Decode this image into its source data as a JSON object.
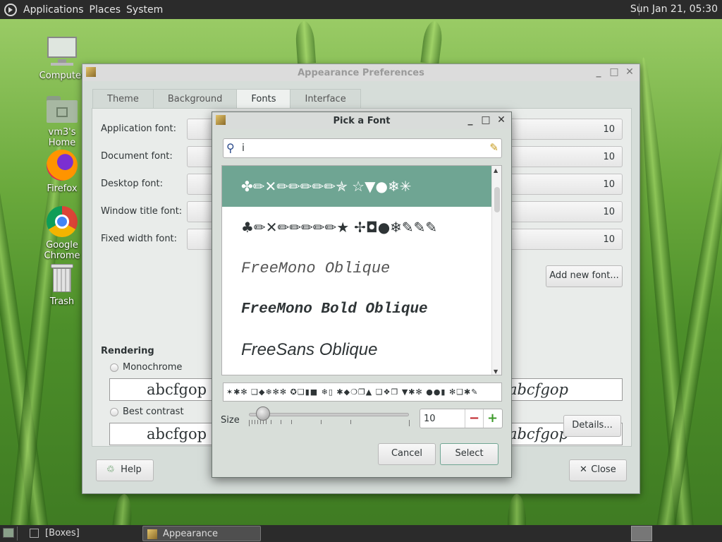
{
  "top_panel": {
    "menus": [
      "Applications",
      "Places",
      "System"
    ],
    "clock": "Sun Jan 21, 05:30"
  },
  "desktop_icons": [
    {
      "label": "Computer",
      "icon": "computer-icon"
    },
    {
      "label": "vm3's Home",
      "icon": "home-folder-icon"
    },
    {
      "label": "Firefox",
      "icon": "firefox-icon"
    },
    {
      "label": "Google Chrome",
      "icon": "chrome-icon"
    },
    {
      "label": "Trash",
      "icon": "trash-icon"
    }
  ],
  "appearance": {
    "title": "Appearance Preferences",
    "tabs": [
      "Theme",
      "Background",
      "Fonts",
      "Interface"
    ],
    "active_tab": "Fonts",
    "font_rows": [
      {
        "label": "Application font:",
        "size": "10"
      },
      {
        "label": "Document font:",
        "size": "10"
      },
      {
        "label": "Desktop font:",
        "size": "10"
      },
      {
        "label": "Window title font:",
        "size": "10"
      },
      {
        "label": "Fixed width font:",
        "size": "10"
      }
    ],
    "add_font_label": "Add new font...",
    "rendering_label": "Rendering",
    "render_options": [
      {
        "label": "Monochrome",
        "sample": "abcfgop"
      },
      {
        "label": "Best contrast",
        "sample": "abcfgop"
      }
    ],
    "details_label": "Details...",
    "help_label": "Help",
    "close_label": "Close"
  },
  "picker": {
    "title": "Pick a Font",
    "search_value": "i",
    "fonts": [
      {
        "text": "✤✏✕✏✏✏✏✏✯ ☆▼●❄✳",
        "style": "dingbat-light",
        "selected": true
      },
      {
        "text": "♣✏✕✏✏✏✏✏★ ✢◘●❄✎✎✎",
        "style": "dingbat-bold",
        "selected": false
      },
      {
        "text": "FreeMono Oblique",
        "style": "mono-oblique",
        "selected": false
      },
      {
        "text": "FreeMono Bold Oblique",
        "style": "mono-bold-oblique",
        "selected": false
      },
      {
        "text": "FreeSans Oblique",
        "style": "sans-oblique",
        "selected": false
      }
    ],
    "preview_text": "✶✱✻ ❑◆❄✻✻ ✪❑▮■ ❄▯ ✱◆❍❐▲ ❑❖❐ ▼✱✻ ●●▮ ✻❑✱✎",
    "size_label": "Size",
    "size_value": "10",
    "size_fraction": 0.05,
    "cancel_label": "Cancel",
    "select_label": "Select"
  },
  "bottom_panel": {
    "tasks": [
      "[Boxes]",
      "Appearance Prefere..."
    ]
  }
}
